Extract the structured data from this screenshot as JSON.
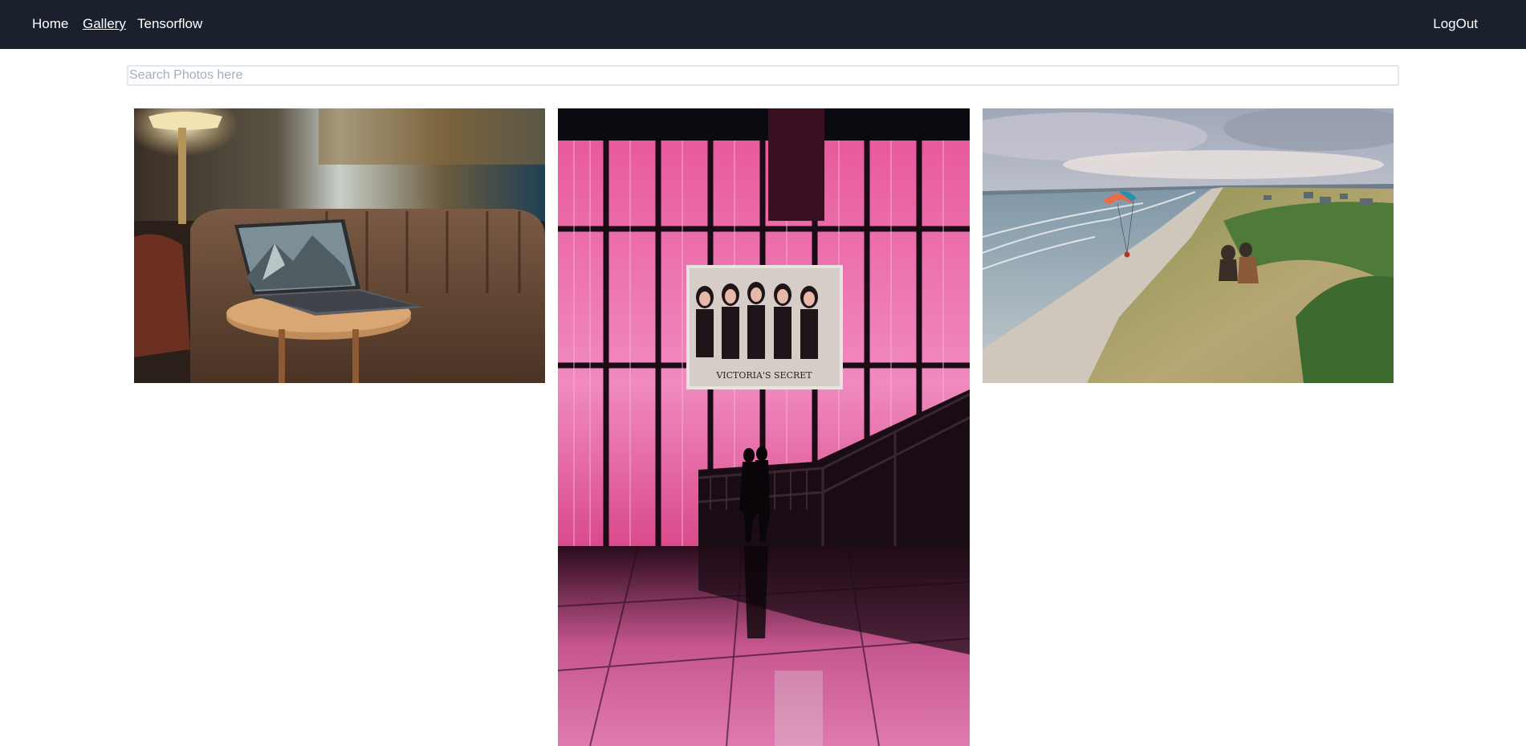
{
  "navbar": {
    "home_label": "Home",
    "gallery_label": "Gallery",
    "tensorflow_label": "Tensorflow",
    "logout_label": "LogOut",
    "background": "#1a202c",
    "active_item": "Gallery"
  },
  "search": {
    "placeholder": "Search Photos here",
    "value": ""
  },
  "gallery": {
    "photos": [
      {
        "subject": "laptop-on-side-table-in-lounge",
        "sign_text": ""
      },
      {
        "subject": "pink-lit-mall-atrium-with-staircase",
        "sign_text": "VICTORIA'S SECRET"
      },
      {
        "subject": "paraglider-over-beach-cliffs",
        "sign_text": ""
      }
    ]
  }
}
